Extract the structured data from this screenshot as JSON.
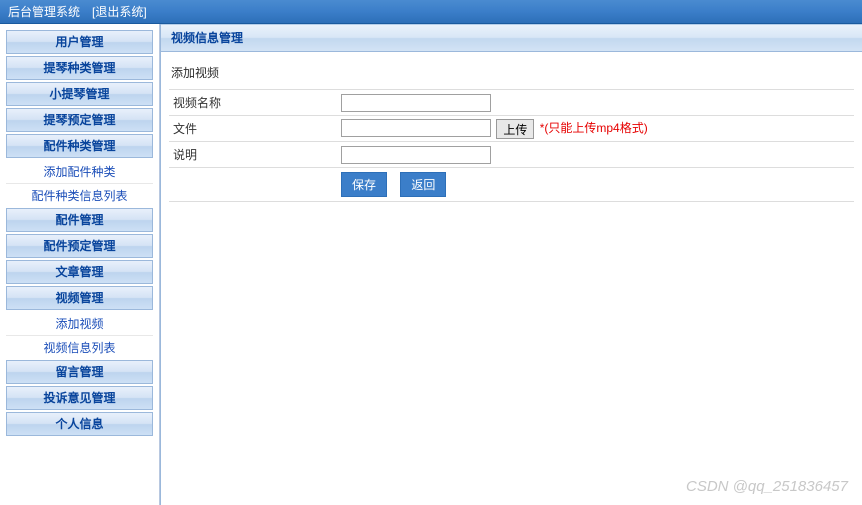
{
  "header": {
    "title": "后台管理系统",
    "logout": "[退出系统]"
  },
  "sidebar": {
    "groups": [
      {
        "label": "用户管理",
        "items": []
      },
      {
        "label": "提琴种类管理",
        "items": []
      },
      {
        "label": "小提琴管理",
        "items": []
      },
      {
        "label": "提琴预定管理",
        "items": []
      },
      {
        "label": "配件种类管理",
        "items": [
          "添加配件种类",
          "配件种类信息列表"
        ]
      },
      {
        "label": "配件管理",
        "items": []
      },
      {
        "label": "配件预定管理",
        "items": []
      },
      {
        "label": "文章管理",
        "items": []
      },
      {
        "label": "视频管理",
        "items": [
          "添加视频",
          "视频信息列表"
        ]
      },
      {
        "label": "留言管理",
        "items": []
      },
      {
        "label": "投诉意见管理",
        "items": []
      },
      {
        "label": "个人信息",
        "items": []
      }
    ]
  },
  "main": {
    "panel_title": "视频信息管理",
    "section_title": "添加视频",
    "fields": {
      "name_label": "视频名称",
      "name_value": "",
      "file_label": "文件",
      "file_value": "",
      "upload_btn": "上传",
      "file_hint": "*(只能上传mp4格式)",
      "desc_label": "说明",
      "desc_value": ""
    },
    "buttons": {
      "save": "保存",
      "back": "返回"
    }
  },
  "watermark": "CSDN @qq_251836457"
}
